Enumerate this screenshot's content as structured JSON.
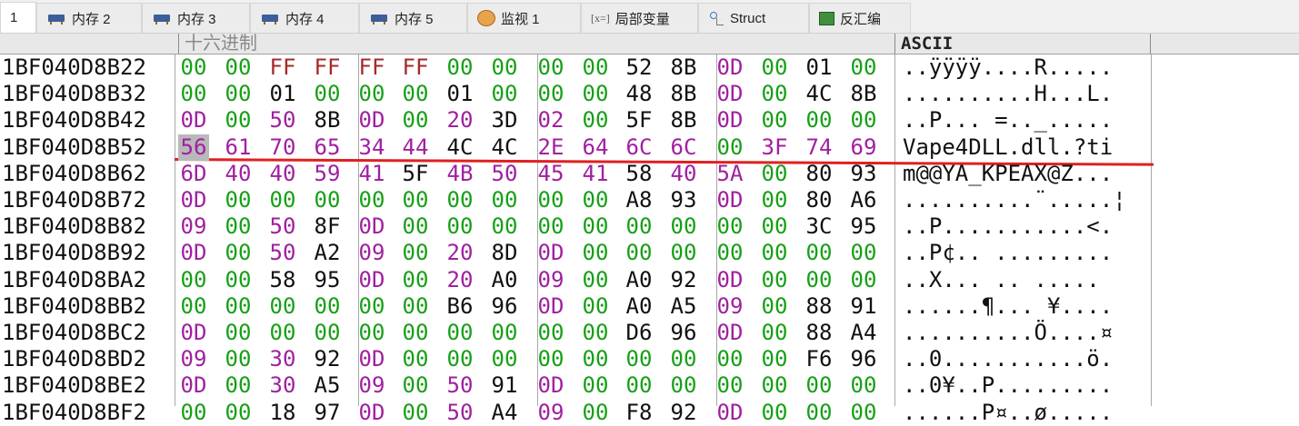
{
  "tabs": [
    {
      "label": "1",
      "icon": "",
      "active": true
    },
    {
      "label": "内存 2",
      "icon": "memory-icon",
      "active": false
    },
    {
      "label": "内存 3",
      "icon": "memory-icon",
      "active": false
    },
    {
      "label": "内存 4",
      "icon": "memory-icon",
      "active": false
    },
    {
      "label": "内存 5",
      "icon": "memory-icon",
      "active": false
    },
    {
      "label": "监视 1",
      "icon": "watch-icon",
      "active": false
    },
    {
      "label": "局部变量",
      "icon": "local-vars-icon",
      "icon_text": "[x=]",
      "active": false
    },
    {
      "label": "Struct",
      "icon": "struct-icon",
      "active": false
    },
    {
      "label": "反汇编",
      "icon": "disassembly-icon",
      "active": false
    }
  ],
  "header": {
    "hex_title": "十六进制",
    "ascii_title": "ASCII"
  },
  "colors": {
    "zero": "#17a017",
    "ff": "#a52a2a",
    "purple": "#a020a0",
    "black": "#111111",
    "highlight": "#b9b9b9",
    "annotation_line": "#e02020"
  },
  "rows": [
    {
      "address": "1BF040D8B22",
      "bytes": [
        "00",
        "00",
        "FF",
        "FF",
        "FF",
        "FF",
        "00",
        "00",
        "00",
        "00",
        "52",
        "8B",
        "0D",
        "00",
        "01",
        "00"
      ],
      "ascii": "..ÿÿÿÿ....R....."
    },
    {
      "address": "1BF040D8B32",
      "bytes": [
        "00",
        "00",
        "01",
        "00",
        "00",
        "00",
        "01",
        "00",
        "00",
        "00",
        "48",
        "8B",
        "0D",
        "00",
        "4C",
        "8B"
      ],
      "ascii": "..........H...L."
    },
    {
      "address": "1BF040D8B42",
      "bytes": [
        "0D",
        "00",
        "50",
        "8B",
        "0D",
        "00",
        "20",
        "3D",
        "02",
        "00",
        "5F",
        "8B",
        "0D",
        "00",
        "00",
        "00"
      ],
      "ascii": "..P... =.._....."
    },
    {
      "address": "1BF040D8B52",
      "bytes": [
        "56",
        "61",
        "70",
        "65",
        "34",
        "44",
        "4C",
        "4C",
        "2E",
        "64",
        "6C",
        "6C",
        "00",
        "3F",
        "74",
        "69"
      ],
      "ascii": "Vape4DLL.dll.?ti",
      "highlight_first": true
    },
    {
      "address": "1BF040D8B62",
      "bytes": [
        "6D",
        "40",
        "40",
        "59",
        "41",
        "5F",
        "4B",
        "50",
        "45",
        "41",
        "58",
        "40",
        "5A",
        "00",
        "80",
        "93"
      ],
      "ascii": "m@@YA_KPEAX@Z..."
    },
    {
      "address": "1BF040D8B72",
      "bytes": [
        "0D",
        "00",
        "00",
        "00",
        "00",
        "00",
        "00",
        "00",
        "00",
        "00",
        "A8",
        "93",
        "0D",
        "00",
        "80",
        "A6"
      ],
      "ascii": "..........¨.....¦"
    },
    {
      "address": "1BF040D8B82",
      "bytes": [
        "09",
        "00",
        "50",
        "8F",
        "0D",
        "00",
        "00",
        "00",
        "00",
        "00",
        "00",
        "00",
        "00",
        "00",
        "3C",
        "95"
      ],
      "ascii": "..P...........<."
    },
    {
      "address": "1BF040D8B92",
      "bytes": [
        "0D",
        "00",
        "50",
        "A2",
        "09",
        "00",
        "20",
        "8D",
        "0D",
        "00",
        "00",
        "00",
        "00",
        "00",
        "00",
        "00"
      ],
      "ascii": "..P¢.. ........."
    },
    {
      "address": "1BF040D8BA2",
      "bytes": [
        "00",
        "00",
        "58",
        "95",
        "0D",
        "00",
        "20",
        "A0",
        "09",
        "00",
        "A0",
        "92",
        "0D",
        "00",
        "00",
        "00"
      ],
      "ascii": "..X... .. ....."
    },
    {
      "address": "1BF040D8BB2",
      "bytes": [
        "00",
        "00",
        "00",
        "00",
        "00",
        "00",
        "B6",
        "96",
        "0D",
        "00",
        "A0",
        "A5",
        "09",
        "00",
        "88",
        "91"
      ],
      "ascii": "......¶... ¥...."
    },
    {
      "address": "1BF040D8BC2",
      "bytes": [
        "0D",
        "00",
        "00",
        "00",
        "00",
        "00",
        "00",
        "00",
        "00",
        "00",
        "D6",
        "96",
        "0D",
        "00",
        "88",
        "A4"
      ],
      "ascii": "..........Ö....¤"
    },
    {
      "address": "1BF040D8BD2",
      "bytes": [
        "09",
        "00",
        "30",
        "92",
        "0D",
        "00",
        "00",
        "00",
        "00",
        "00",
        "00",
        "00",
        "00",
        "00",
        "F6",
        "96"
      ],
      "ascii": "..0...........ö."
    },
    {
      "address": "1BF040D8BE2",
      "bytes": [
        "0D",
        "00",
        "30",
        "A5",
        "09",
        "00",
        "50",
        "91",
        "0D",
        "00",
        "00",
        "00",
        "00",
        "00",
        "00",
        "00"
      ],
      "ascii": "..0¥..P........."
    },
    {
      "address": "1BF040D8BF2",
      "bytes": [
        "00",
        "00",
        "18",
        "97",
        "0D",
        "00",
        "50",
        "A4",
        "09",
        "00",
        "F8",
        "92",
        "0D",
        "00",
        "00",
        "00"
      ],
      "ascii": "......P¤..ø....."
    }
  ]
}
